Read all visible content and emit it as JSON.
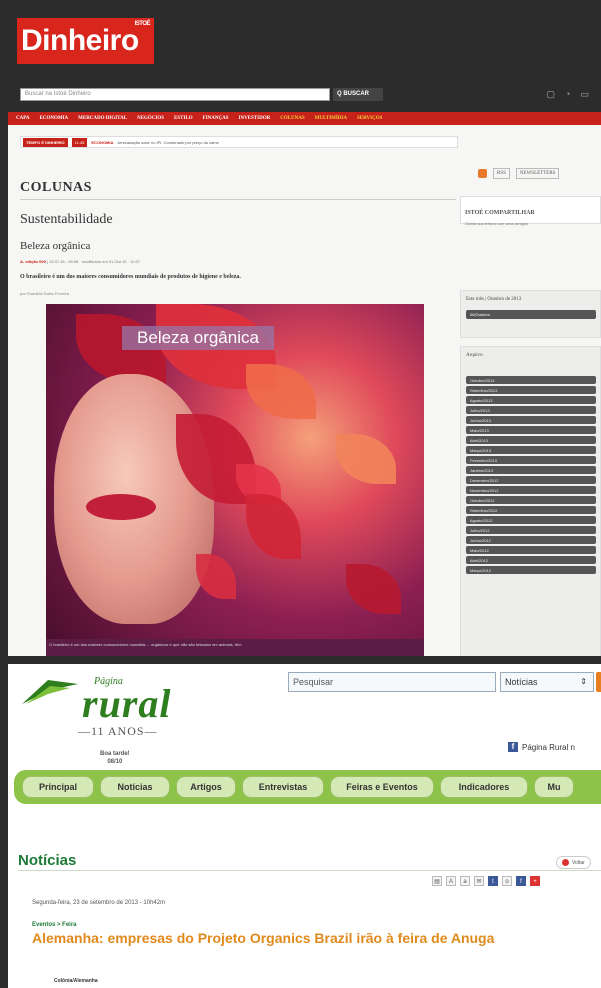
{
  "dinheiro": {
    "logo": "Dinheiro",
    "logo_small": "ISTOÉ",
    "search_placeholder": "Buscar na Istoé Dinheiro",
    "search_button": "Q BUSCAR",
    "nav": [
      "CAPA",
      "ECONOMIA",
      "MERCADO DIGITAL",
      "NEGÓCIOS",
      "ESTILO",
      "FINANÇAS",
      "INVESTIDOR",
      "COLUNAS",
      "MULTIMÍDIA",
      "SERVIÇOS"
    ],
    "ticker_badge": "TEMPO É DINHEIRO",
    "ticker_badge2": "11:45",
    "ticker_red": "ECONOMIA",
    "ticker_text": "Arrecadação solar no IPI. Condenado por preço da carne",
    "columns_title": "COLUNAS",
    "section": "Sustentabilidade",
    "subtitle": "Beleza orgânica",
    "meta_red": "A- edição 000",
    "meta": "| 13.07.15 - 09:36 · modificado em 01.Out.15 · 12:07",
    "lead": "O brasileiro é um dos maiores consumidores mundiais de produtos de higiene e beleza.",
    "author": "por Ruanilda Sales Ferreira",
    "image_caption": "Beleza orgânica",
    "caption_bar": "O brasileiro é um dos maiores consumidores mundiais ... orgânicos e que não são testados em animais, têm",
    "side_rss": "RSS",
    "side_news": "NEWSLETTERS",
    "share_title": "ISTOÉ COMPARTILHAR",
    "share_text": "Divida sua leitura com seus amigos",
    "month_title": "Este mês | Outubro de 2013",
    "month_item": "06/Outubro",
    "archive_title": "Arquivo",
    "archive": [
      "Outubro/2013",
      "Setembro/2013",
      "Agosto/2013",
      "Julho/2013",
      "Junho/2013",
      "Maio/2013",
      "Abril/2013",
      "Março/2013",
      "Fevereiro/2013",
      "Janeiro/2013",
      "Dezembro/2012",
      "Novembro/2012",
      "Outubro/2012",
      "Setembro/2012",
      "Agosto/2012",
      "Julho/2012",
      "Junho/2012",
      "Maio/2012",
      "Abril/2012",
      "Março/2012"
    ]
  },
  "rural": {
    "logo_pagina": "Página",
    "logo_rural": "rural",
    "logo_anos": "—11 ANOS—",
    "logo_date_1": "Boa tarde!",
    "logo_date_2": "08/10",
    "search_placeholder": "Pesquisar",
    "select_value": "Notícias",
    "fb_label": "Página Rural n",
    "nav": [
      "Principal",
      "Notícias",
      "Artigos",
      "Entrevistas",
      "Feiras e Eventos",
      "Indicadores",
      "Mu"
    ],
    "page_title": "Notícias",
    "back_label": "Voltar",
    "date": "Segunda-feira, 23 de setembro de 2013 - 10h42m",
    "breadcrumb": "Eventos > Feira",
    "headline": "Alemanha: empresas do Projeto Organics Brazil irão à feira de Anuga",
    "place": "Colônia/Alemanha"
  },
  "colors": {
    "dinheiro_red": "#c7221a",
    "rural_green": "#1d7a36",
    "rural_orange": "#e08a1e",
    "nav_green": "#8ec34a"
  }
}
